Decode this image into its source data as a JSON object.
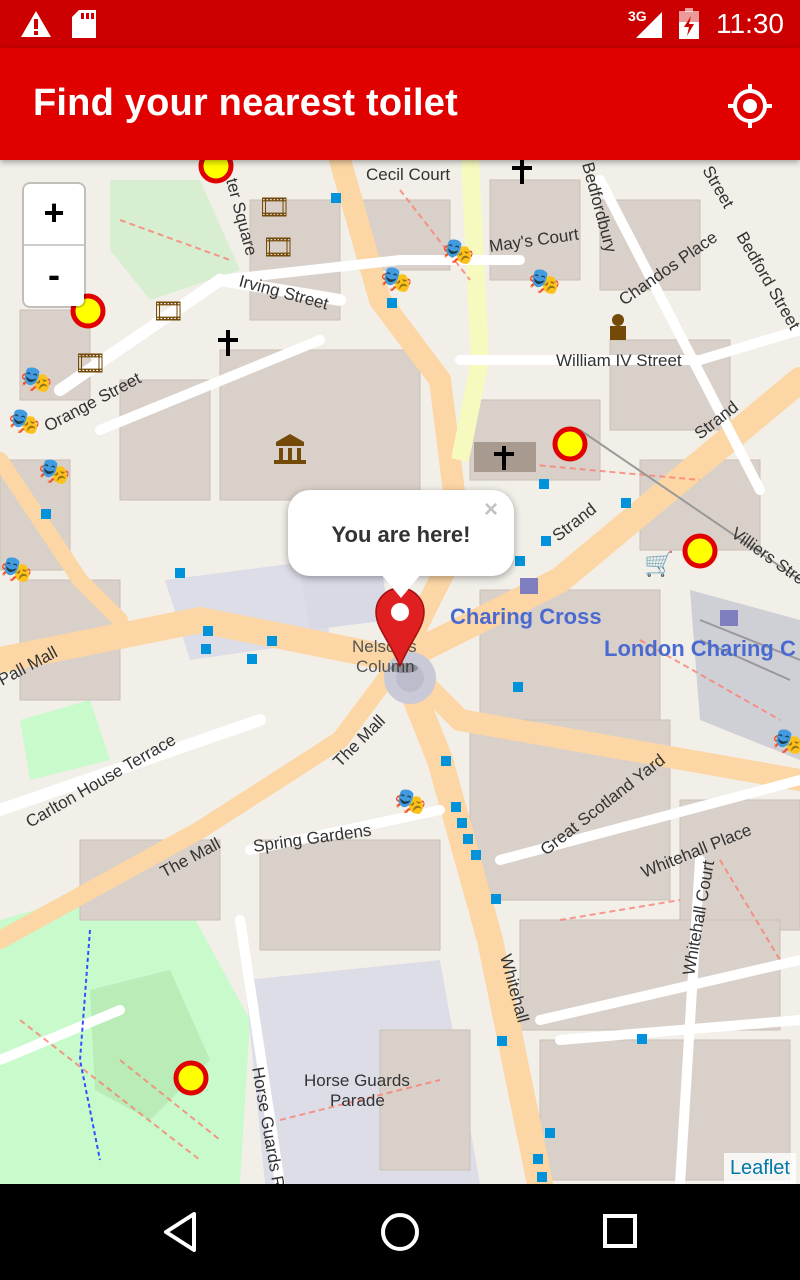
{
  "status_bar": {
    "time": "11:30",
    "network": "3G",
    "icons": [
      "warning-icon",
      "sd-card-icon",
      "signal-icon",
      "battery-charging-icon"
    ]
  },
  "app_bar": {
    "title": "Find your nearest toilet",
    "action_icon": "my-location-icon"
  },
  "map": {
    "zoom_in": "+",
    "zoom_out": "-",
    "popup_text": "You are here!",
    "popup_close": "×",
    "attribution": "Leaflet",
    "place_labels": {
      "cecil_court": "Cecil Court",
      "mays_court": "May's Court",
      "bedfordbury": "Bedfordbury",
      "chandos_place": "Chandos Place",
      "irving_street": "Irving Street",
      "william_iv_street": "William IV Street",
      "orange_street": "Orange Street",
      "strand_1": "Strand",
      "strand_2": "Strand",
      "charing_cross": "Charing Cross",
      "london_charing_cross": "London Charing C",
      "villiers_street": "Villiers Street",
      "nelsons_column_1": "Nelson's",
      "nelsons_column_2": "Column",
      "the_mall_1": "The Mall",
      "the_mall_2": "The Mall",
      "carlton_house_terrace": "Carlton House Terrace",
      "spring_gardens": "Spring Gardens",
      "great_scotland_yard": "Great Scotland Yard",
      "whitehall_place": "Whitehall Place",
      "whitehall_court": "Whitehall Court",
      "whitehall": "Whitehall",
      "horse_guards_parade_1": "Horse Guards",
      "horse_guards_parade_2": "Parade",
      "horse_guards_road": "Horse Guards R",
      "pall_mall": "Pall Mall",
      "leicester_square": "ter Square",
      "bedford_street": "Bedford Street",
      "street_top": "Street"
    },
    "toilet_marker_count": 6,
    "colors": {
      "marker_ring": "#e00000",
      "marker_fill": "#ffff00",
      "app_bar": "#e00000",
      "status_bar": "#cc0000",
      "transit_label": "#4a6ad0"
    }
  },
  "nav_bar": {
    "buttons": [
      "back-icon",
      "home-icon",
      "recents-icon"
    ]
  }
}
